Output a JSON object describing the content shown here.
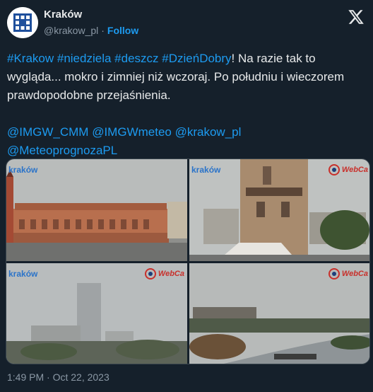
{
  "account": {
    "name": "Kraków",
    "handle": "@krakow_pl",
    "separator": "·",
    "follow_label": "Follow"
  },
  "tweet": {
    "line1_tags": [
      "#Krakow",
      "#niedziela",
      "#deszcz",
      "#DzieńDobry"
    ],
    "line1_rest": "! Na razie tak to wygląda... mokro i zimniej niż wczoraj. Po południu i wieczorem prawdopodobne przejaśnienia.",
    "mentions": [
      "@IMGW_CMM",
      "@IMGWmeteo",
      "@krakow_pl",
      "@MeteoprognozaPL"
    ]
  },
  "images": [
    {
      "label": "kraków"
    },
    {
      "label": "kraków",
      "badge": "WebCa"
    },
    {
      "label": "kraków",
      "badge": "WebCa"
    },
    {
      "badge": "WebCa"
    }
  ],
  "timestamp": "1:49 PM · Oct 22, 2023",
  "colors": {
    "accent": "#1d9bf0",
    "background": "#15202b",
    "muted": "#8b98a5",
    "webcam_red": "#c8302b"
  }
}
